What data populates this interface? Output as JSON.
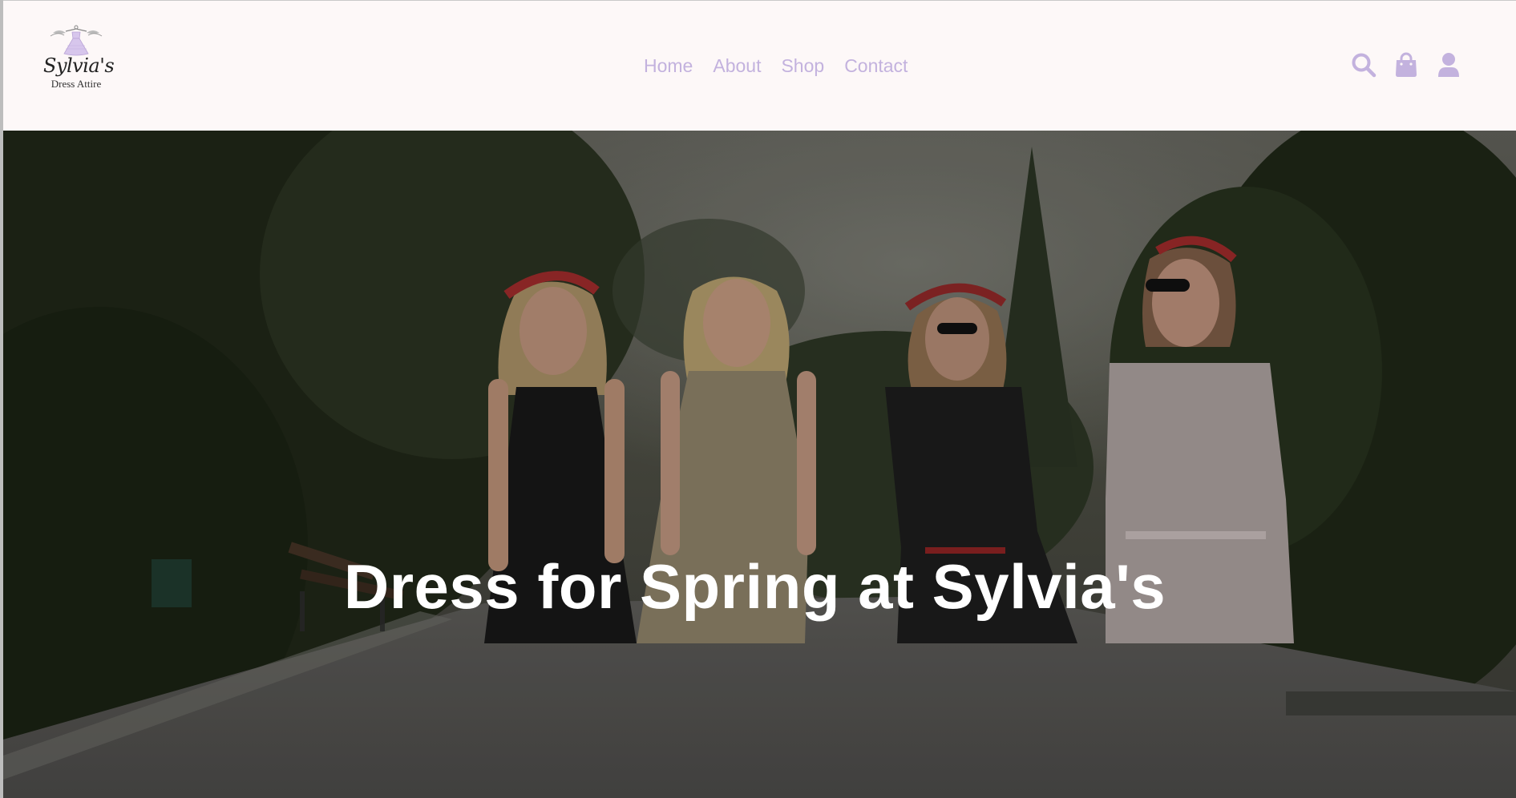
{
  "header": {
    "logo": {
      "name": "Sylvia's",
      "tagline": "Dress Attire",
      "icon": "dress-hanger-icon"
    },
    "nav": [
      {
        "label": "Home"
      },
      {
        "label": "About"
      },
      {
        "label": "Shop"
      },
      {
        "label": "Contact"
      }
    ],
    "actions": [
      {
        "icon": "search-icon"
      },
      {
        "icon": "shopping-bag-icon"
      },
      {
        "icon": "user-icon"
      }
    ]
  },
  "hero": {
    "title": "Dress for Spring at Sylvia's"
  },
  "colors": {
    "accent": "#c3b2de",
    "header_bg": "#fdf8f8",
    "title": "#ffffff"
  }
}
